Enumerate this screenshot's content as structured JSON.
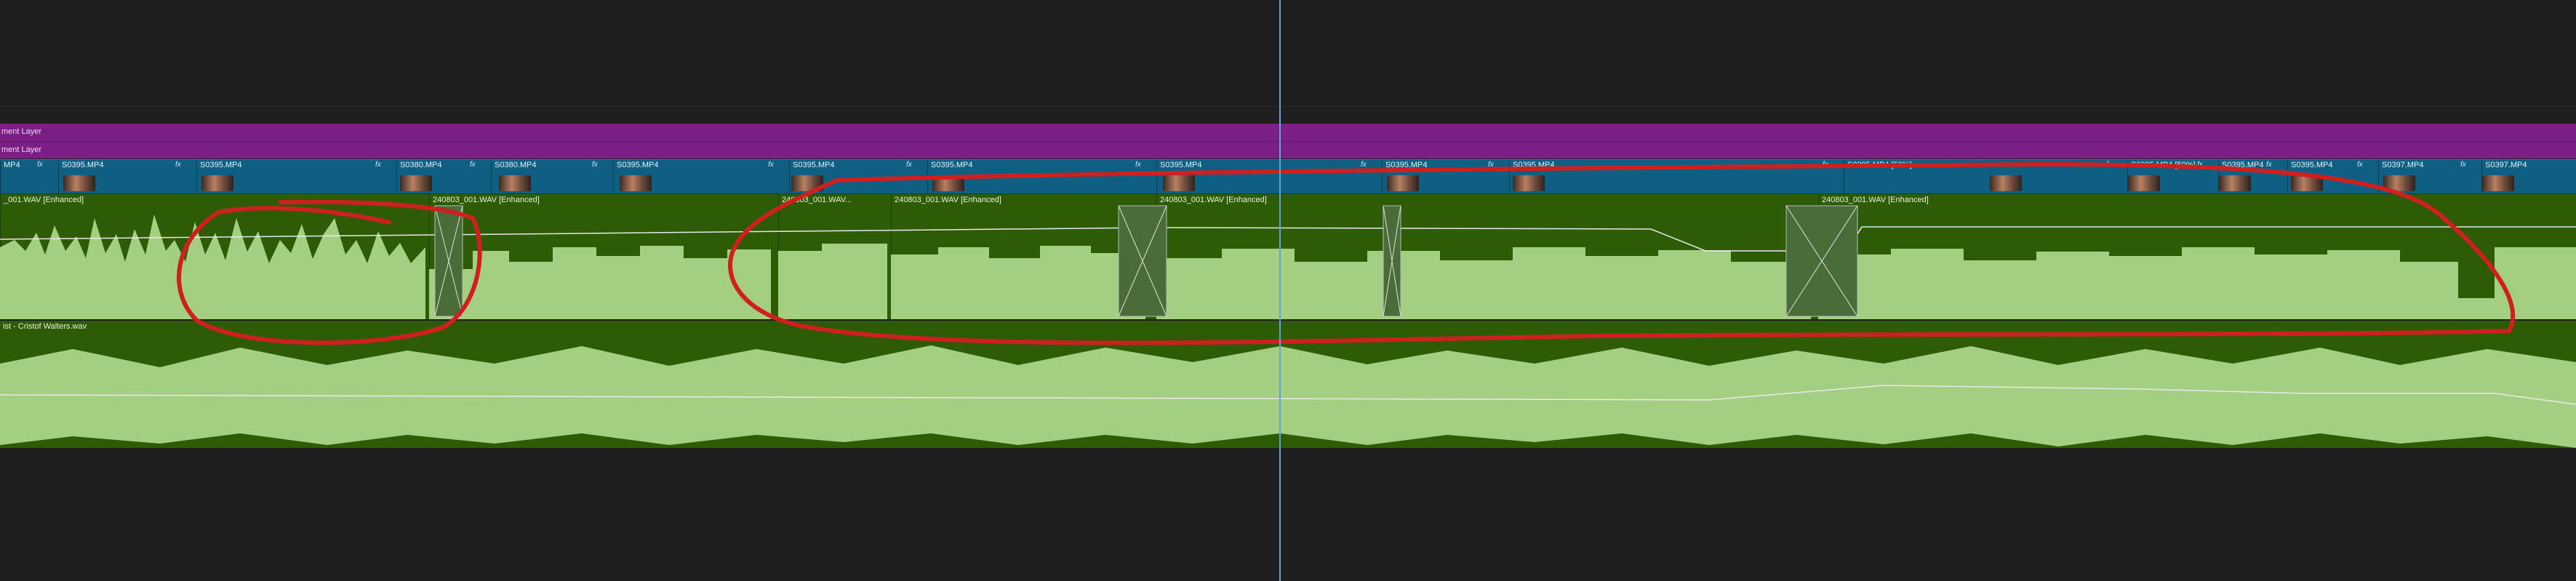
{
  "tracks": {
    "adjustment_1": "ment Layer",
    "adjustment_2": "ment Layer"
  },
  "video_clips": [
    {
      "label": "MP4",
      "fx": ""
    },
    {
      "label": "S0395.MP4",
      "fx": "fx"
    },
    {
      "label": "S0395.MP4",
      "fx": "fx"
    },
    {
      "label": "S0380.MP4",
      "fx": "fx"
    },
    {
      "label": "S0380.MP4",
      "fx": "fx"
    },
    {
      "label": "S0395.MP4",
      "fx": "fx"
    },
    {
      "label": "S0395.MP4",
      "fx": "fx"
    },
    {
      "label": "S0395.MP4",
      "fx": "fx"
    },
    {
      "label": "S0395.MP4",
      "fx": "fx"
    },
    {
      "label": "S0395.MP4",
      "fx": "fx"
    },
    {
      "label": "S0395.MP4",
      "fx": "fx"
    },
    {
      "label": "S0395.MP4 [50%]",
      "fx": "fx"
    },
    {
      "label": "S0395.MP4 [50%]",
      "fx": "fx"
    },
    {
      "label": "S0395.MP4",
      "fx": "fx"
    },
    {
      "label": "S0395.MP4",
      "fx": "fx"
    },
    {
      "label": "S0397.MP4",
      "fx": "fx"
    },
    {
      "label": "S0397.MP4",
      "fx": "fx"
    }
  ],
  "audio_clips": [
    {
      "label": "_001.WAV [Enhanced]"
    },
    {
      "label": "240803_001.WAV [Enhanced]"
    },
    {
      "label": "240803_001.WAV..."
    },
    {
      "label": "240803_001.WAV [Enhanced]"
    },
    {
      "label": "240803_001.WAV [Enhanced]"
    },
    {
      "label": "240803_001.WAV [Enhanced]"
    }
  ],
  "music_track": {
    "label": "ist - Cristof Walters.wav"
  },
  "colors": {
    "adjustment": "#7b1f86",
    "video": "#0f5f83",
    "audio_dark": "#2e5b06",
    "audio_wave": "#a4cf82",
    "annotation": "#d01f1f",
    "playhead": "#5aa7d6"
  }
}
